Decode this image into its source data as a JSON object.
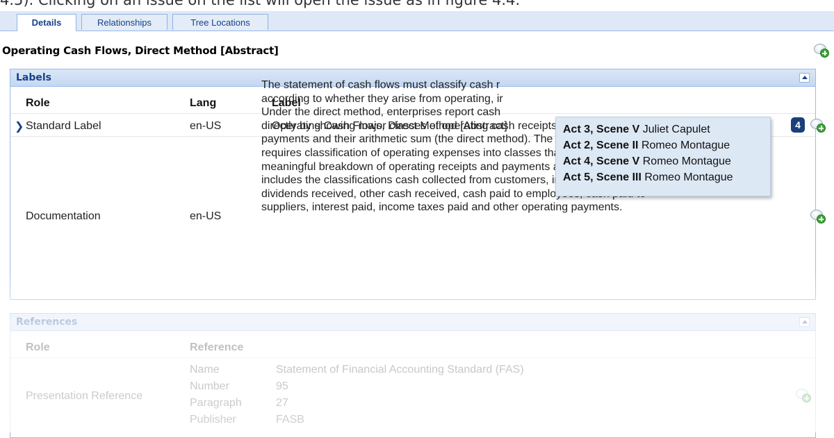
{
  "caption": "4.5). Clicking on an issue on the list will open the issue as in figure 4.4.",
  "tabs": [
    {
      "label": "Details"
    },
    {
      "label": "Relationships"
    },
    {
      "label": "Tree Locations"
    }
  ],
  "title": "Operating Cash Flows, Direct Method [Abstract]",
  "labels": {
    "header": "Labels",
    "columns": {
      "role": "Role",
      "lang": "Lang",
      "label": "Label"
    },
    "rows": [
      {
        "role": "Standard Label",
        "lang": "en-US",
        "label": "Operating Cash Flows, Direct Method [Abstract]"
      },
      {
        "role": "Documentation",
        "lang": "en-US",
        "lines": [
          "The statement of cash flows must classify cash r",
          "according to whether they arise from operating, ir",
          "Under the direct method, enterprises report cash",
          "directly by showing major classes of operating cash receipts and cash",
          "payments and their arithmetic sum (the direct method). The direct method",
          "requires classification of operating expenses into classes that provide a",
          "meaningful breakdown of operating receipts and payments and usually",
          "includes the classifications cash collected from customers, interest and",
          "dividends received, other cash received, cash paid to employees, cash paid to",
          "suppliers, interest paid, income taxes paid and other operating payments."
        ]
      }
    ]
  },
  "issues": {
    "count": "4",
    "items": [
      {
        "scene": "Act 3, Scene V",
        "person": "Juliet Capulet"
      },
      {
        "scene": "Act 2, Scene II",
        "person": "Romeo Montague"
      },
      {
        "scene": "Act 4, Scene V",
        "person": "Romeo Montague"
      },
      {
        "scene": "Act 5, Scene III",
        "person": "Romeo Montague"
      }
    ]
  },
  "references": {
    "header": "References",
    "columns": {
      "role": "Role",
      "reference": "Reference"
    },
    "role": "Presentation Reference",
    "fields": [
      {
        "key": "Name",
        "value": "Statement of Financial Accounting Standard (FAS)"
      },
      {
        "key": "Number",
        "value": "95"
      },
      {
        "key": "Paragraph",
        "value": "27"
      },
      {
        "key": "Publisher",
        "value": "FASB"
      }
    ]
  },
  "icons": {
    "add_comment": "add-comment-icon",
    "collapse": "collapse-up-icon",
    "row_marker": "chevron-right-icon"
  },
  "colors": {
    "header_bg": "#c5d8f1",
    "header_text": "#15428b",
    "border": "#99bbe8",
    "badge": "#1a3f7a",
    "tooltip_bg": "#dde8f5",
    "plus_green": "#3aa334"
  }
}
